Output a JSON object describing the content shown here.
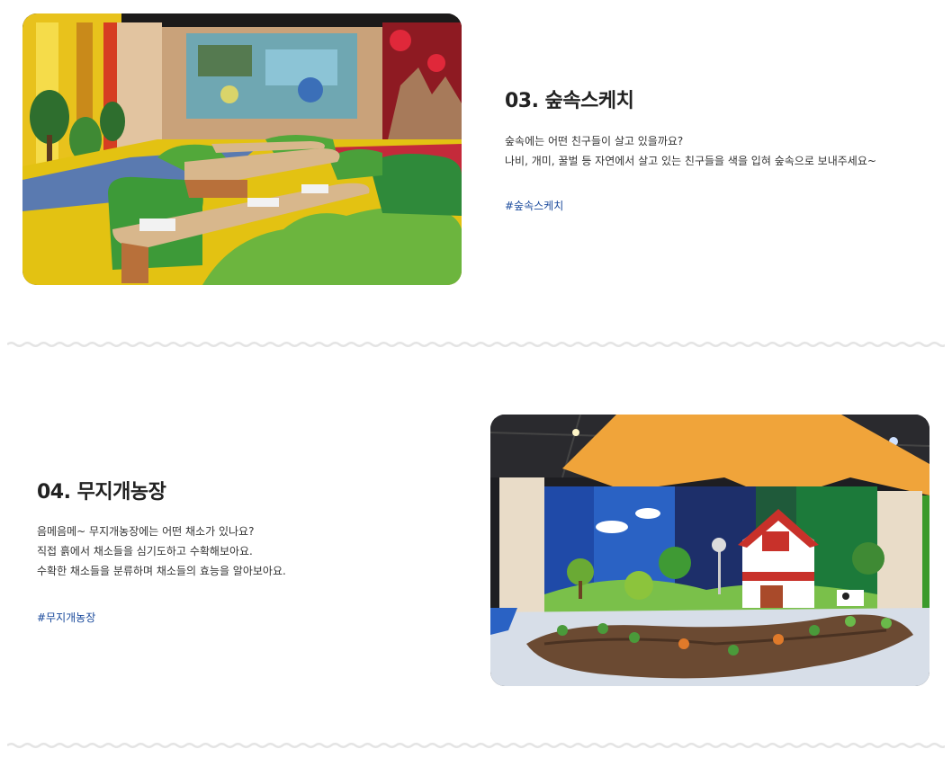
{
  "sections": [
    {
      "number_title": "03. 숲속스케치",
      "lines": [
        "숲속에는 어떤 친구들이 살고 있을까요?",
        "나비, 개미, 꿀벌 등 자연에서 살고 있는 친구들을 색을 입혀 숲속으로 보내주세요~"
      ],
      "tag": "#숲속스케치"
    },
    {
      "number_title": "04. 무지개농장",
      "lines": [
        "음메음메~ 무지개농장에는 어떤 채소가 있나요?",
        "직접 흙에서 채소들을 심기도하고 수확해보아요.",
        "수확한 채소들을 분류하며 채소들의 효능을 알아보아요."
      ],
      "tag": "#무지개농장"
    }
  ],
  "colors": {
    "tag": "#1a4a9c",
    "divider": "#e4e4e4"
  }
}
